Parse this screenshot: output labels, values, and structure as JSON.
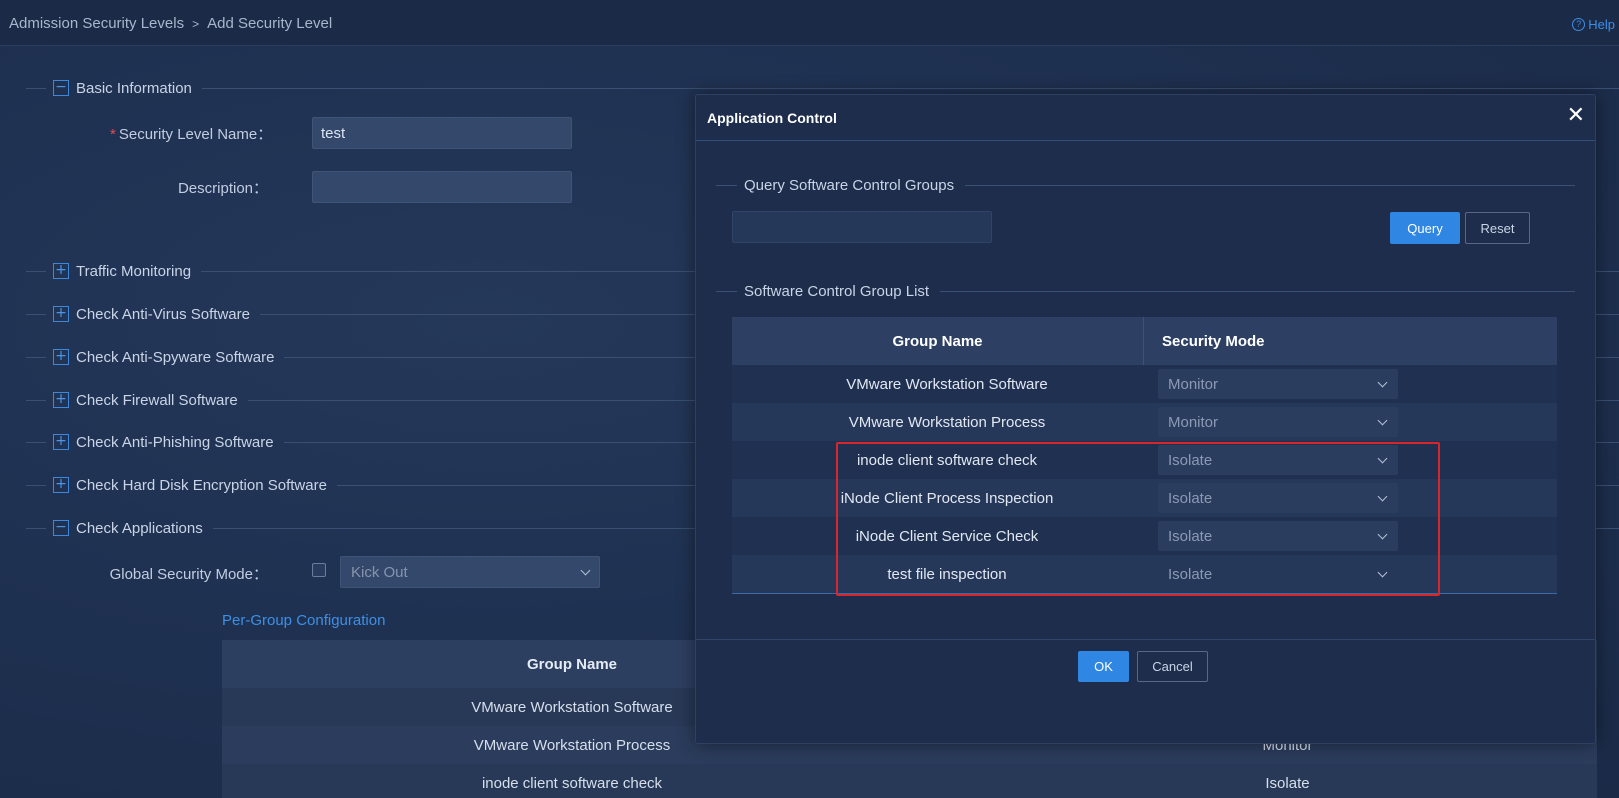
{
  "breadcrumb": {
    "parent": "Admission Security Levels",
    "separator": ">",
    "current": "Add Security Level"
  },
  "help": {
    "label": "Help",
    "icon": "question-circle-icon"
  },
  "basic_info": {
    "title": "Basic Information",
    "name_label": "Security Level Name：",
    "name_value": "test",
    "description_label": "Description：",
    "description_value": ""
  },
  "sections": [
    {
      "title": "Traffic Monitoring",
      "state": "collapsed"
    },
    {
      "title": "Check Anti-Virus Software",
      "state": "collapsed"
    },
    {
      "title": "Check Anti-Spyware Software",
      "state": "collapsed"
    },
    {
      "title": "Check Firewall Software",
      "state": "collapsed"
    },
    {
      "title": "Check Anti-Phishing Software",
      "state": "collapsed"
    },
    {
      "title": "Check Hard Disk Encryption Software",
      "state": "collapsed"
    }
  ],
  "check_applications": {
    "title": "Check Applications",
    "global_mode_label": "Global Security Mode：",
    "global_mode_value": "Kick Out",
    "per_group_link": "Per-Group Configuration",
    "table": {
      "headers": [
        "Group Name",
        ""
      ],
      "rows": [
        {
          "group": "VMware Workstation Software",
          "mode": ""
        },
        {
          "group": "VMware Workstation Process",
          "mode": "Monitor"
        },
        {
          "group": "inode client  software check",
          "mode": "Isolate"
        }
      ]
    }
  },
  "modal": {
    "title": "Application Control",
    "close_icon": "close-icon",
    "query_section": "Query Software Control Groups",
    "query_placeholder": "",
    "query_button": "Query",
    "reset_button": "Reset",
    "list_section": "Software Control Group List",
    "table": {
      "headers": [
        "Group Name",
        "Security Mode"
      ],
      "rows": [
        {
          "group": "VMware Workstation Software",
          "mode": "Monitor"
        },
        {
          "group": "VMware Workstation Process",
          "mode": "Monitor"
        },
        {
          "group": "inode client  software check",
          "mode": "Isolate"
        },
        {
          "group": "iNode Client Process Inspection",
          "mode": "Isolate"
        },
        {
          "group": "iNode Client Service Check",
          "mode": "Isolate"
        },
        {
          "group": "test file inspection",
          "mode": "Isolate"
        }
      ]
    },
    "ok_button": "OK",
    "cancel_button": "Cancel"
  },
  "colors": {
    "accent": "#2f86e3",
    "highlight": "#d8262b",
    "required": "#e84b4b"
  }
}
